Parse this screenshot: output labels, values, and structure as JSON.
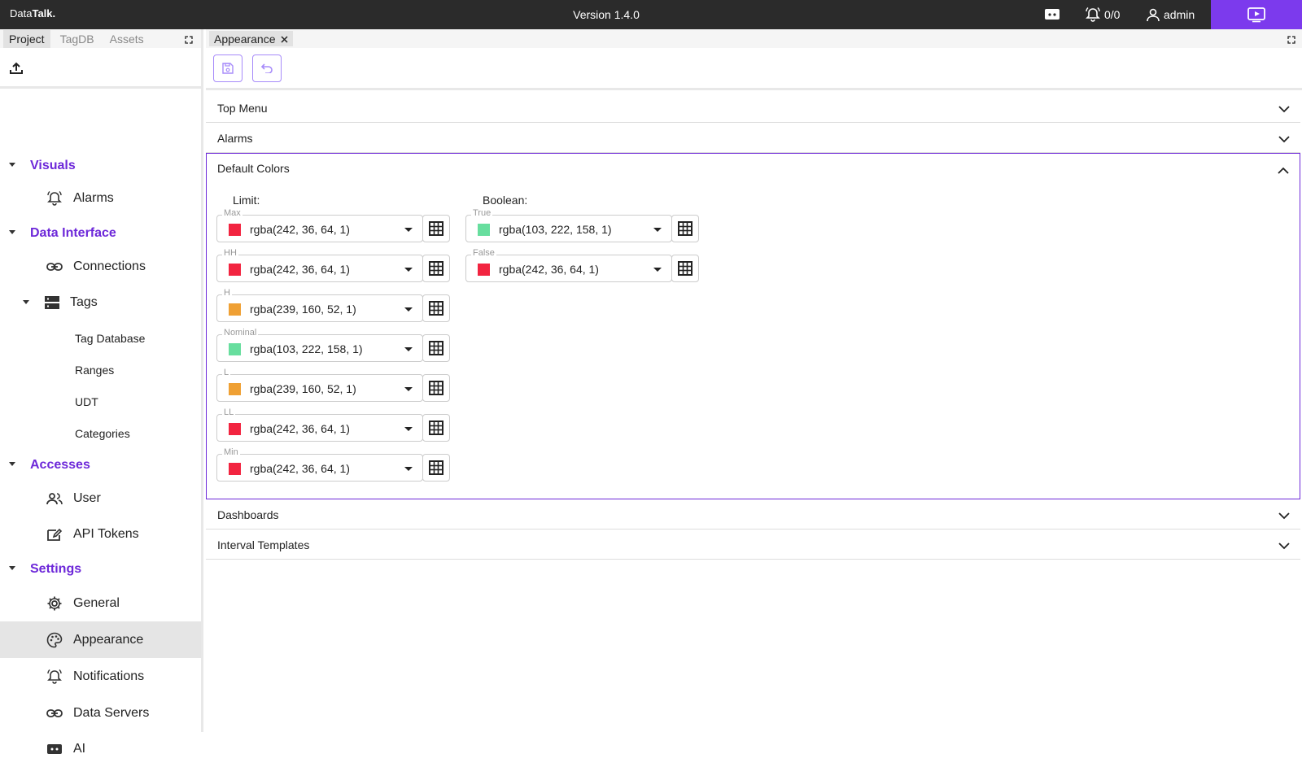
{
  "topbar": {
    "brand_prefix": "Data",
    "brand_bold": "Talk.",
    "version": "Version 1.4.0",
    "alarm_count": "0/0",
    "user": "admin",
    "accent": "#7c3aed"
  },
  "left_tabs": [
    "Project",
    "TagDB",
    "Assets"
  ],
  "tree": {
    "sections": [
      {
        "label": "Visuals"
      },
      {
        "label": "Data Interface"
      },
      {
        "label": "Accesses"
      },
      {
        "label": "Settings"
      }
    ],
    "items": {
      "alarms": "Alarms",
      "connections": "Connections",
      "tags": "Tags",
      "tag_database": "Tag Database",
      "ranges": "Ranges",
      "udt": "UDT",
      "categories": "Categories",
      "user": "User",
      "api_tokens": "API Tokens",
      "general": "General",
      "appearance": "Appearance",
      "notifications": "Notifications",
      "data_servers": "Data Servers",
      "ai": "AI"
    }
  },
  "editor_tab": "Appearance",
  "accordion": {
    "top_menu": "Top Menu",
    "alarms": "Alarms",
    "default_colors": "Default Colors",
    "dashboards": "Dashboards",
    "interval_templates": "Interval Templates"
  },
  "default_colors": {
    "limit_title": "Limit:",
    "boolean_title": "Boolean:",
    "limit": [
      {
        "label": "Max",
        "value": "rgba(242, 36, 64, 1)",
        "color": "#f22440"
      },
      {
        "label": "HH",
        "value": "rgba(242, 36, 64, 1)",
        "color": "#f22440"
      },
      {
        "label": "H",
        "value": "rgba(239, 160, 52, 1)",
        "color": "#efa034"
      },
      {
        "label": "Nominal",
        "value": "rgba(103, 222, 158, 1)",
        "color": "#67de9e"
      },
      {
        "label": "L",
        "value": "rgba(239, 160, 52, 1)",
        "color": "#efa034"
      },
      {
        "label": "LL",
        "value": "rgba(242, 36, 64, 1)",
        "color": "#f22440"
      },
      {
        "label": "Min",
        "value": "rgba(242, 36, 64, 1)",
        "color": "#f22440"
      }
    ],
    "boolean": [
      {
        "label": "True",
        "value": "rgba(103, 222, 158, 1)",
        "color": "#67de9e"
      },
      {
        "label": "False",
        "value": "rgba(242, 36, 64, 1)",
        "color": "#f22440"
      }
    ]
  }
}
